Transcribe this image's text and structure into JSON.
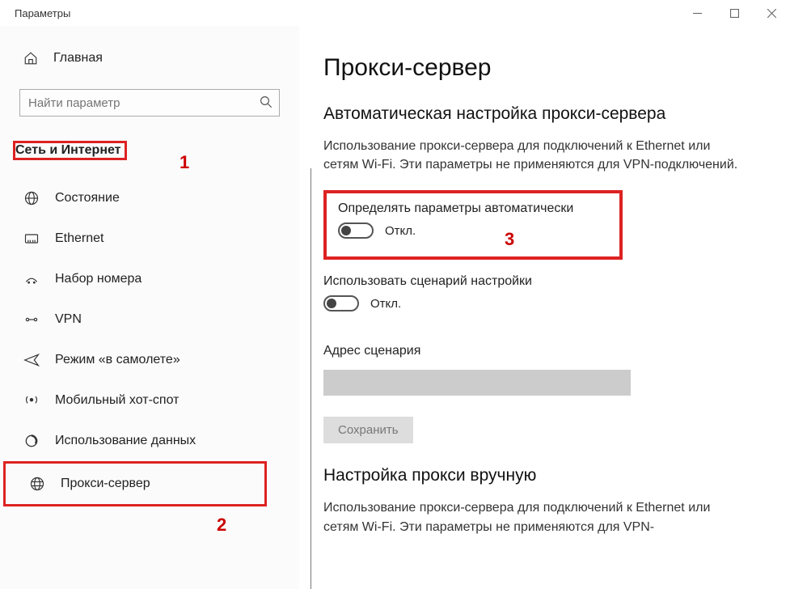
{
  "window": {
    "title": "Параметры"
  },
  "sidebar": {
    "home": "Главная",
    "search_placeholder": "Найти параметр",
    "section": "Сеть и Интернет",
    "items": [
      {
        "label": "Состояние"
      },
      {
        "label": "Ethernet"
      },
      {
        "label": "Набор номера"
      },
      {
        "label": "VPN"
      },
      {
        "label": "Режим «в самолете»"
      },
      {
        "label": "Мобильный хот-спот"
      },
      {
        "label": "Использование данных"
      },
      {
        "label": "Прокси-сервер"
      }
    ]
  },
  "annotations": {
    "n1": "1",
    "n2": "2",
    "n3": "3"
  },
  "main": {
    "title": "Прокси-сервер",
    "auto": {
      "heading": "Автоматическая настройка прокси-сервера",
      "desc": "Использование прокси-сервера для подключений к Ethernet или сетям Wi-Fi. Эти параметры не применяются для VPN-подключений.",
      "detect_label": "Определять параметры автоматически",
      "detect_state": "Откл.",
      "script_label": "Использовать сценарий настройки",
      "script_state": "Откл.",
      "addr_label": "Адрес сценария",
      "save": "Сохранить"
    },
    "manual": {
      "heading": "Настройка прокси вручную",
      "desc": "Использование прокси-сервера для подключений к Ethernet или сетям Wi-Fi. Эти параметры не применяются для VPN-"
    }
  }
}
